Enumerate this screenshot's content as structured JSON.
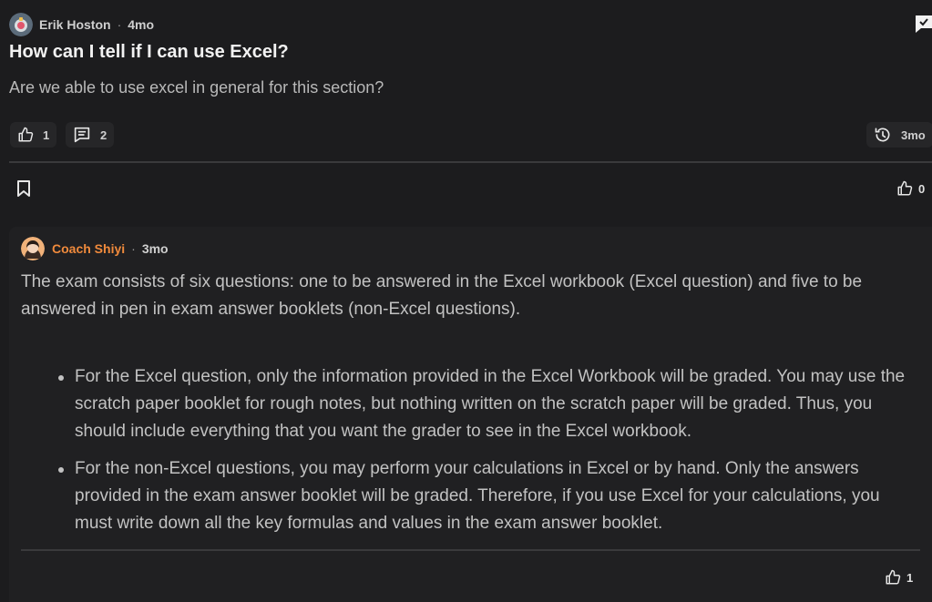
{
  "question": {
    "author": "Erik Hoston",
    "separator": "·",
    "time": "4mo",
    "title": "How can I tell if I can use Excel?",
    "body": "Are we able to use excel in general for this section?",
    "likes": "1",
    "comments": "2",
    "history": "3mo",
    "upvotes": "0"
  },
  "answer": {
    "author": "Coach Shiyi",
    "separator": "·",
    "time": "3mo",
    "paragraph": "The exam consists of six questions: one to be answered in the Excel workbook (Excel question) and five to be answered in pen in exam answer booklets (non-Excel questions).",
    "bullets": [
      "For the Excel question, only the information provided in the Excel Workbook will be graded. You may use the scratch paper booklet for rough notes, but nothing written on the scratch paper will be graded. Thus, you should include everything that you want the grader to see in the Excel workbook.",
      "For the non-Excel questions, you may perform your calculations in Excel or by hand. Only the answers provided in the exam answer booklet will be graded. Therefore, if you use Excel for your calculations, you must write down all the key formulas and values in the exam answer booklet."
    ],
    "likes": "1"
  },
  "colors": {
    "background": "#1c1c1e",
    "answer_background": "#202022",
    "coach_accent": "#f08a3c",
    "divider": "#3a3a3c"
  },
  "icons": {
    "like": "thumbs-up-icon",
    "comment": "comment-icon",
    "history": "history-icon",
    "bookmark": "bookmark-icon",
    "report": "chat-check-icon"
  }
}
